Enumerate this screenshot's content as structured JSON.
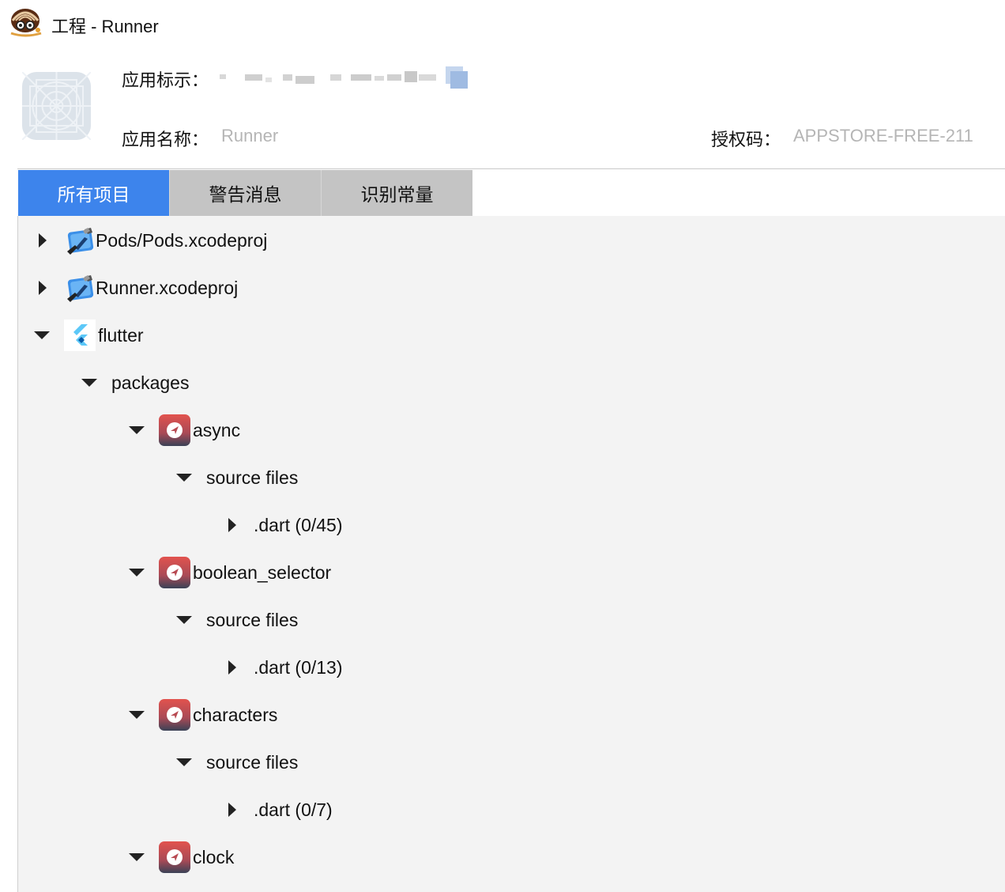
{
  "window": {
    "title": "工程 - Runner"
  },
  "app_info": {
    "id_label": "应用标示：",
    "name_label": "应用名称：",
    "name_value": "Runner",
    "license_label": "授权码：",
    "license_value": "APPSTORE-FREE-211"
  },
  "tabs": [
    {
      "label": "所有项目",
      "active": true
    },
    {
      "label": "警告消息",
      "active": false
    },
    {
      "label": "识别常量",
      "active": false
    }
  ],
  "tree": {
    "pods_proj": {
      "label": "Pods/Pods.xcodeproj",
      "expanded": false,
      "icon": "xcode-project-icon"
    },
    "runner_proj": {
      "label": "Runner.xcodeproj",
      "expanded": false,
      "icon": "xcode-project-icon"
    },
    "flutter": {
      "label": "flutter",
      "expanded": true,
      "icon": "flutter-icon"
    },
    "packages": {
      "label": "packages",
      "expanded": true
    },
    "async": {
      "label": "async",
      "expanded": true,
      "icon": "dart-package-icon"
    },
    "async_sources": {
      "label": "source files",
      "expanded": true
    },
    "async_dart": {
      "label": ".dart (0/45)",
      "expanded": false
    },
    "boolean_selector": {
      "label": "boolean_selector",
      "expanded": true,
      "icon": "dart-package-icon"
    },
    "boolean_selector_sources": {
      "label": "source files",
      "expanded": true
    },
    "boolean_selector_dart": {
      "label": ".dart (0/13)",
      "expanded": false
    },
    "characters": {
      "label": "characters",
      "expanded": true,
      "icon": "dart-package-icon"
    },
    "characters_sources": {
      "label": "source files",
      "expanded": true
    },
    "characters_dart": {
      "label": ".dart (0/7)",
      "expanded": false
    },
    "clock": {
      "label": "clock",
      "expanded": true,
      "icon": "dart-package-icon"
    }
  },
  "colors": {
    "tab_active": "#3d84ec",
    "tab_inactive": "#c4c4c4",
    "tree_background": "#f3f3f3",
    "muted_value": "#b5b5b5"
  }
}
